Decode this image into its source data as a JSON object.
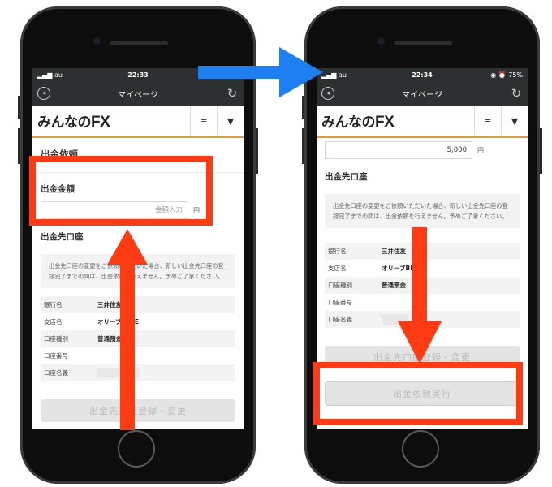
{
  "left_phone": {
    "status_bar": {
      "carrier": "au",
      "time": "22:33",
      "right": "◉ ⏰"
    },
    "nav_bar": {
      "title": "マイページ"
    },
    "app_header": {
      "logo_a": "みんなの",
      "logo_b": "FX",
      "menu_icon": "≡",
      "dropdown_icon": "▼"
    },
    "page_title": "出金依頼",
    "amount_label": "出金金額",
    "amount_placeholder": "金額入力",
    "yen": "円",
    "account_section_title": "出金先口座",
    "notice": "出金先口座の変更をご依頼いただいた場合、新しい出金先口座の登録完了までの間は、出金依頼を行えません。予めご了承ください。",
    "info": [
      {
        "key": "銀行名",
        "value": "三井住友"
      },
      {
        "key": "支店名",
        "value": "オリーブBLUE"
      },
      {
        "key": "口座種別",
        "value": "普通預金"
      },
      {
        "key": "口座番号",
        "value": ""
      },
      {
        "key": "口座名義",
        "value": ""
      }
    ],
    "register_button": "出金先口座登録・変更"
  },
  "right_phone": {
    "status_bar": {
      "carrier": "au",
      "time": "22:34",
      "right": "◉ ⏰ 75%"
    },
    "nav_bar": {
      "title": "マイページ"
    },
    "app_header": {
      "logo_a": "みんなの",
      "logo_b": "FX",
      "menu_icon": "≡",
      "dropdown_icon": "▼"
    },
    "amount_value": "5,000",
    "yen": "円",
    "account_section_title": "出金先口座",
    "notice": "出金先口座の変更をご依頼いただいた場合、新しい出金先口座の登録完了までの間は、出金依頼を行えません。予めご了承ください。",
    "info": [
      {
        "key": "銀行名",
        "value": "三井住友"
      },
      {
        "key": "支店名",
        "value": "オリーブBLUE"
      },
      {
        "key": "口座種別",
        "value": "普通預金"
      },
      {
        "key": "口座番号",
        "value": ""
      },
      {
        "key": "口座名義",
        "value": ""
      }
    ],
    "register_button": "出金先口座登録・変更",
    "submit_button": "出金依頼実行"
  },
  "colors": {
    "highlight": "#ff3b14",
    "arrow_blue": "#1e7ff0",
    "accent_orange": "#e59a2a"
  }
}
